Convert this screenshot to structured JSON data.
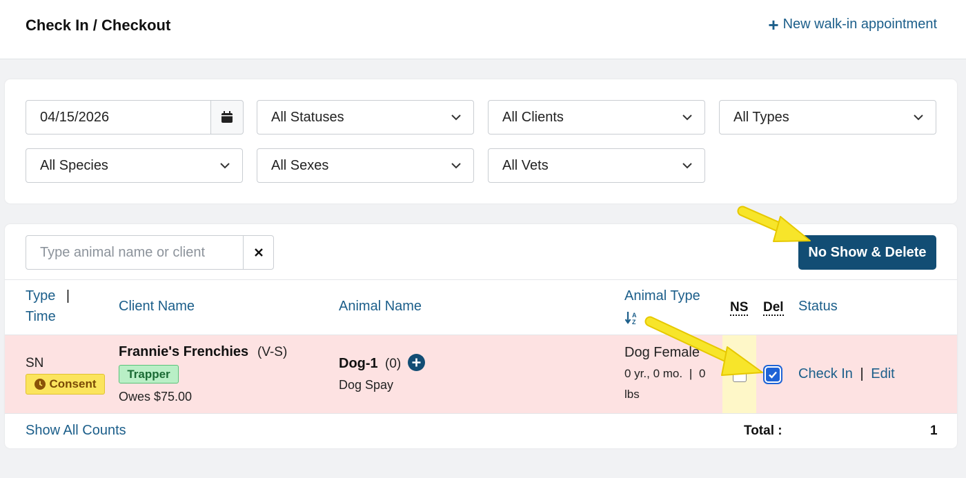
{
  "header": {
    "title": "Check In / Checkout",
    "walkin_label": "New walk-in appointment"
  },
  "filters": {
    "date_value": "04/15/2026",
    "status": "All Statuses",
    "clients": "All Clients",
    "types": "All Types",
    "species": "All Species",
    "sexes": "All Sexes",
    "vets": "All Vets"
  },
  "search": {
    "placeholder": "Type animal name or client",
    "value": ""
  },
  "actions": {
    "no_show_delete": "No Show & Delete"
  },
  "columns": {
    "type": "Type",
    "time": "Time",
    "client": "Client Name",
    "animal": "Animal Name",
    "animal_type": "Animal Type",
    "ns": "NS",
    "del": "Del",
    "status": "Status"
  },
  "rows": [
    {
      "type": "SN",
      "consent": "Consent",
      "client_name": "Frannie's Frenchies",
      "client_code": "(V-S)",
      "client_badge": "Trapper",
      "owes": "Owes $75.00",
      "animal_name": "Dog-1",
      "animal_count": "(0)",
      "procedure": "Dog Spay",
      "animal_type": "Dog Female",
      "age": "0 yr., 0 mo.",
      "weight": "0",
      "weight_unit": "lbs",
      "ns_checked": false,
      "del_checked": true,
      "check_in": "Check In",
      "edit": "Edit"
    }
  ],
  "footer": {
    "show_counts": "Show All Counts",
    "total_label": "Total :",
    "total_value": "1"
  },
  "colors": {
    "link": "#1b5e8a",
    "primary_button": "#124d74",
    "row_highlight": "#fde2e2",
    "ns_column": "#fef7c8",
    "consent_badge": "#fbe45d",
    "trapper_badge": "#b9efc6",
    "annotation_arrow": "#f7e52a"
  },
  "icons": {
    "walkin": "plus-icon",
    "date": "calendar-icon",
    "dropdowns": "chevron-down-icon",
    "clear": "close-icon",
    "consent": "clock-icon",
    "animal_add": "plus-circle-icon",
    "sort": "sort-alpha-desc-icon"
  }
}
